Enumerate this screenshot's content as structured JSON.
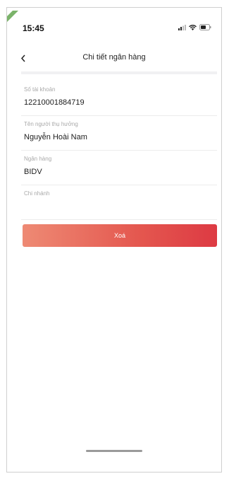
{
  "status_bar": {
    "time": "15:45",
    "icons": [
      "signal-icon",
      "wifi-icon",
      "battery-icon"
    ]
  },
  "header": {
    "back_icon": "chevron-left-icon",
    "title": "Chi tiết ngân hàng"
  },
  "fields": [
    {
      "label": "Số tài khoản",
      "value": "12210001884719"
    },
    {
      "label": "Tên người thụ hưởng",
      "value": "Nguyễn Hoài Nam"
    },
    {
      "label": "Ngân hàng",
      "value": "BIDV"
    },
    {
      "label": "Chi nhánh",
      "value": ""
    }
  ],
  "actions": {
    "delete_label": "Xoá"
  },
  "colors": {
    "accent_start": "#ee8a74",
    "accent_end": "#dd3a43"
  }
}
